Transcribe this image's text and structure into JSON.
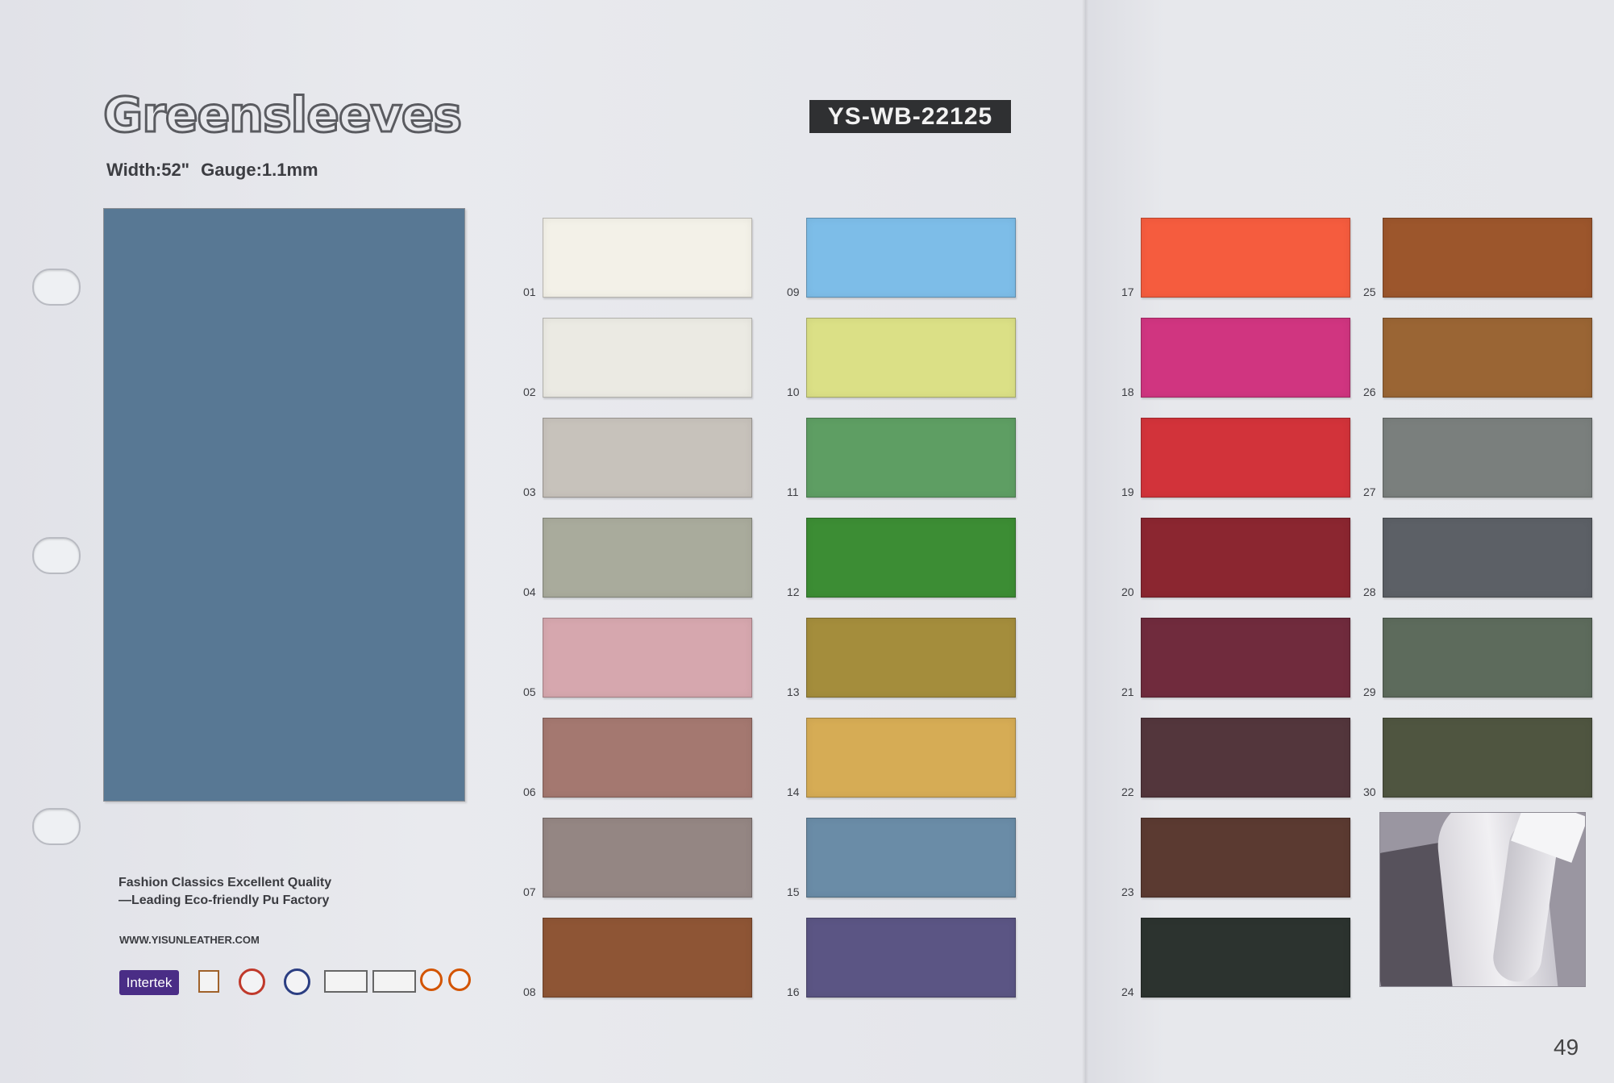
{
  "title": "Greensleeves",
  "specs": {
    "width": "Width:52\"",
    "gauge": "Gauge:1.1mm"
  },
  "code": "YS-WB-22125",
  "tagline": [
    "Fashion Classics Excellent Quality",
    "—Leading Eco-friendly Pu Factory"
  ],
  "website": "WWW.YISUNLEATHER.COM",
  "cert_logo_text": "Intertek",
  "page_number": "49",
  "main_swatch_color": "#587894",
  "swatches": [
    {
      "num": "01",
      "color": "#f3f1e8"
    },
    {
      "num": "02",
      "color": "#ebeae3"
    },
    {
      "num": "03",
      "color": "#c7c2bb"
    },
    {
      "num": "04",
      "color": "#a9ab9c"
    },
    {
      "num": "05",
      "color": "#d6a7ae"
    },
    {
      "num": "06",
      "color": "#a47870"
    },
    {
      "num": "07",
      "color": "#948683"
    },
    {
      "num": "08",
      "color": "#8e5535"
    },
    {
      "num": "09",
      "color": "#7dbde8"
    },
    {
      "num": "10",
      "color": "#dbe086"
    },
    {
      "num": "11",
      "color": "#5e9e63"
    },
    {
      "num": "12",
      "color": "#3c8d34"
    },
    {
      "num": "13",
      "color": "#a48d3c"
    },
    {
      "num": "14",
      "color": "#d6ac55"
    },
    {
      "num": "15",
      "color": "#6a8ca7"
    },
    {
      "num": "16",
      "color": "#5b5584"
    },
    {
      "num": "17",
      "color": "#f55c3e"
    },
    {
      "num": "18",
      "color": "#d03580"
    },
    {
      "num": "19",
      "color": "#d2333a"
    },
    {
      "num": "20",
      "color": "#8b2630"
    },
    {
      "num": "21",
      "color": "#702b3d"
    },
    {
      "num": "22",
      "color": "#53363c"
    },
    {
      "num": "23",
      "color": "#5b3a31"
    },
    {
      "num": "24",
      "color": "#2c332f"
    },
    {
      "num": "25",
      "color": "#9c562c"
    },
    {
      "num": "26",
      "color": "#9a6534"
    },
    {
      "num": "27",
      "color": "#7a7f7d"
    },
    {
      "num": "28",
      "color": "#5c6066"
    },
    {
      "num": "29",
      "color": "#5d6b5c"
    },
    {
      "num": "30",
      "color": "#4f5540"
    }
  ]
}
